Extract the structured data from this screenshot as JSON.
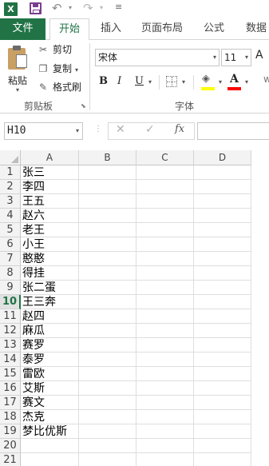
{
  "qat": {
    "app_icon": "excel-logo-icon",
    "app_icon_text": "X",
    "save_icon": "save-icon",
    "undo_icon": "undo-icon",
    "redo_icon": "redo-icon",
    "customize_icon": "customize-toolbar-icon"
  },
  "tabs": {
    "file": "文件",
    "home": "开始",
    "insert": "插入",
    "page_layout": "页面布局",
    "formulas": "公式",
    "data": "数据"
  },
  "clipboard": {
    "paste": "粘贴",
    "cut": "剪切",
    "copy": "复制",
    "format_painter": "格式刷",
    "group_label": "剪贴板"
  },
  "font": {
    "name": "宋体",
    "size": "11",
    "bold": "B",
    "italic": "I",
    "underline": "U",
    "font_color_letter": "A",
    "grow_letter": "A",
    "group_label": "字体",
    "fill_color": "#ffff00",
    "text_color": "#ff0000"
  },
  "formula_bar": {
    "name_box": "H10",
    "cancel": "✕",
    "enter": "✓",
    "fx": "fx",
    "value": ""
  },
  "colors": {
    "accent": "#217346"
  },
  "grid": {
    "columns": [
      "A",
      "B",
      "C",
      "D"
    ],
    "rows": [
      {
        "n": "1",
        "a": "张三"
      },
      {
        "n": "2",
        "a": "李四"
      },
      {
        "n": "3",
        "a": "王五"
      },
      {
        "n": "4",
        "a": "赵六"
      },
      {
        "n": "5",
        "a": "老王"
      },
      {
        "n": "6",
        "a": "小王"
      },
      {
        "n": "7",
        "a": "憨憨"
      },
      {
        "n": "8",
        "a": "得挂"
      },
      {
        "n": "9",
        "a": "张二蛋"
      },
      {
        "n": "10",
        "a": "王三奔"
      },
      {
        "n": "11",
        "a": "赵四"
      },
      {
        "n": "12",
        "a": "麻瓜"
      },
      {
        "n": "13",
        "a": "赛罗"
      },
      {
        "n": "14",
        "a": "泰罗"
      },
      {
        "n": "15",
        "a": "雷欧"
      },
      {
        "n": "16",
        "a": "艾斯"
      },
      {
        "n": "17",
        "a": "赛文"
      },
      {
        "n": "18",
        "a": "杰克"
      },
      {
        "n": "19",
        "a": "梦比优斯"
      },
      {
        "n": "20",
        "a": ""
      },
      {
        "n": "21",
        "a": ""
      }
    ],
    "active_row": "10"
  }
}
